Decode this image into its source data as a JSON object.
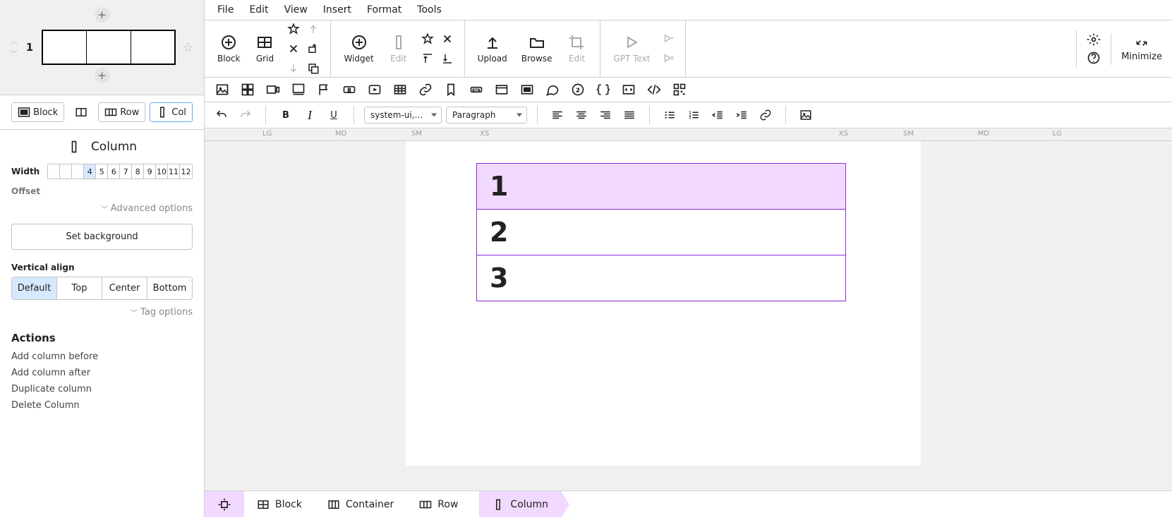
{
  "sidebar": {
    "block_index": "1",
    "tabs": {
      "block": "Block",
      "row": "Row",
      "col": "Col"
    },
    "editing_label": "Column",
    "width_label": "Width",
    "width_options": [
      "",
      "",
      "",
      "4",
      "5",
      "6",
      "7",
      "8",
      "9",
      "10",
      "11",
      "12"
    ],
    "width_selected_index": 3,
    "offset_label": "Offset",
    "advanced_label": "Advanced options",
    "set_background": "Set background",
    "valign_label": "Vertical align",
    "valign_options": [
      "Default",
      "Top",
      "Center",
      "Bottom"
    ],
    "valign_selected_index": 0,
    "tag_options": "Tag options",
    "actions_header": "Actions",
    "actions": [
      "Add column before",
      "Add column after",
      "Duplicate column",
      "Delete Column"
    ]
  },
  "menu": {
    "file": "File",
    "edit": "Edit",
    "view": "View",
    "insert": "Insert",
    "format": "Format",
    "tools": "Tools"
  },
  "toolbar": {
    "block": "Block",
    "grid": "Grid",
    "widget": "Widget",
    "edit_w": "Edit",
    "upload": "Upload",
    "browse": "Browse",
    "edit_img": "Edit",
    "gpt": "GPT Text",
    "minimize": "Minimize"
  },
  "format": {
    "font": "system-ui,-ap...",
    "para": "Paragraph"
  },
  "ruler": {
    "lg": "LG",
    "md": "MD",
    "sm": "SM",
    "xs": "XS"
  },
  "canvas": {
    "rows": [
      "1",
      "2",
      "3"
    ]
  },
  "crumbs": {
    "block": "Block",
    "container": "Container",
    "row": "Row",
    "column": "Column"
  }
}
